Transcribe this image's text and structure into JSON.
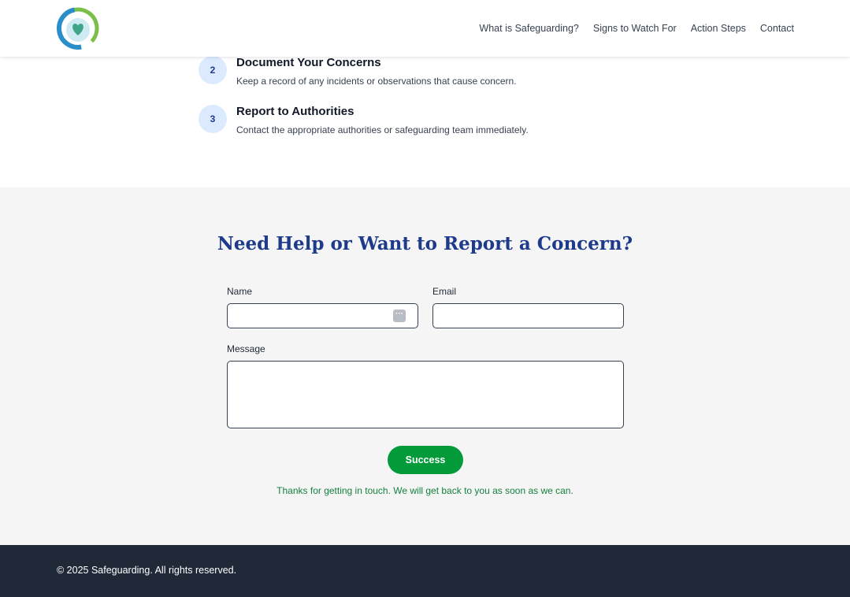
{
  "header": {
    "logo_icon": "heart-hands-logo-icon",
    "nav": [
      "What is Safeguarding?",
      "Signs to Watch For",
      "Action Steps",
      "Contact"
    ]
  },
  "steps": [
    {
      "number": "2",
      "title": "Document Your Concerns",
      "description": "Keep a record of any incidents or observations that cause concern."
    },
    {
      "number": "3",
      "title": "Report to Authorities",
      "description": "Contact the appropriate authorities or safeguarding team immediately."
    }
  ],
  "contact": {
    "title": "Need Help or Want to Report a Concern?",
    "name_label": "Name",
    "name_value": "",
    "email_label": "Email",
    "email_value": "",
    "message_label": "Message",
    "message_value": "",
    "submit_label": "Success",
    "success_message": "Thanks for getting in touch. We will get back to you as soon as we can."
  },
  "footer": {
    "copyright": "© 2025 Safeguarding. All rights reserved."
  },
  "colors": {
    "accent": "#1e3a8a",
    "success": "#039a3a",
    "footer_bg": "#1f2937"
  }
}
